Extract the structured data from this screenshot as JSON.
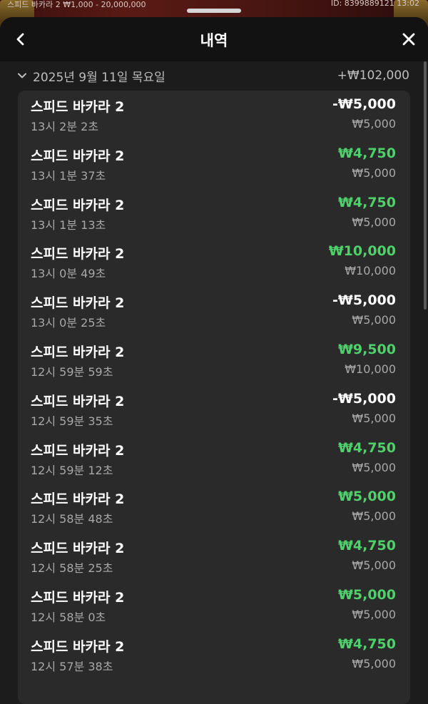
{
  "background": {
    "left_text": "스피드 바카라 2 ₩1,000 - 20,000,000",
    "right_text": "ID: 8399889121 13:02"
  },
  "header": {
    "title": "내역",
    "back_icon": "chevron-left-icon",
    "close_icon": "close-icon"
  },
  "day_group": {
    "date": "2025년 9월 11일 목요일",
    "total": "+₩102,000",
    "toggle_icon": "chevron-down-icon"
  },
  "items": [
    {
      "game": "스피드 바카라 2",
      "time": "13시 2분 2초",
      "result": "-₩5,000",
      "outcome": "loss",
      "bet": "₩5,000"
    },
    {
      "game": "스피드 바카라 2",
      "time": "13시 1분 37초",
      "result": "₩4,750",
      "outcome": "win",
      "bet": "₩5,000"
    },
    {
      "game": "스피드 바카라 2",
      "time": "13시 1분 13초",
      "result": "₩4,750",
      "outcome": "win",
      "bet": "₩5,000"
    },
    {
      "game": "스피드 바카라 2",
      "time": "13시 0분 49초",
      "result": "₩10,000",
      "outcome": "win",
      "bet": "₩10,000"
    },
    {
      "game": "스피드 바카라 2",
      "time": "13시 0분 25초",
      "result": "-₩5,000",
      "outcome": "loss",
      "bet": "₩5,000"
    },
    {
      "game": "스피드 바카라 2",
      "time": "12시 59분 59초",
      "result": "₩9,500",
      "outcome": "win",
      "bet": "₩10,000"
    },
    {
      "game": "스피드 바카라 2",
      "time": "12시 59분 35초",
      "result": "-₩5,000",
      "outcome": "loss",
      "bet": "₩5,000"
    },
    {
      "game": "스피드 바카라 2",
      "time": "12시 59분 12초",
      "result": "₩4,750",
      "outcome": "win",
      "bet": "₩5,000"
    },
    {
      "game": "스피드 바카라 2",
      "time": "12시 58분 48초",
      "result": "₩5,000",
      "outcome": "win",
      "bet": "₩5,000"
    },
    {
      "game": "스피드 바카라 2",
      "time": "12시 58분 25초",
      "result": "₩4,750",
      "outcome": "win",
      "bet": "₩5,000"
    },
    {
      "game": "스피드 바카라 2",
      "time": "12시 58분 0초",
      "result": "₩5,000",
      "outcome": "win",
      "bet": "₩5,000"
    },
    {
      "game": "스피드 바카라 2",
      "time": "12시 57분 38초",
      "result": "₩4,750",
      "outcome": "win",
      "bet": "₩5,000"
    }
  ],
  "colors": {
    "win": "#4ed06a",
    "loss": "#ffffff",
    "panel": "#2a2a2a",
    "header": "#121212"
  }
}
